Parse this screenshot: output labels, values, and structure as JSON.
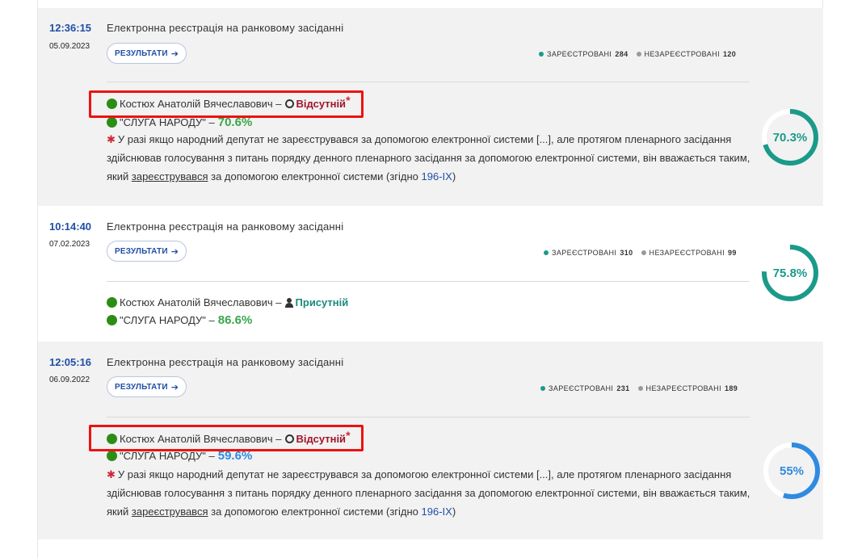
{
  "entries": [
    {
      "time": "12:36:15",
      "date": "05.09.2023",
      "title": "Електронна реєстрація на ранковому засіданні",
      "results_label": "РЕЗУЛЬТАТИ",
      "registered_label": "ЗАРЕЄСТРОВАНІ",
      "registered_count": "284",
      "unregistered_label": "НЕЗАРЕЄСТРОВАНІ",
      "unregistered_count": "120",
      "deputy_name": "Костюх Анатолій Вячеславович –",
      "status": "Відсутній",
      "asterisk": "*",
      "party": "\"СЛУГА НАРОДУ\" –",
      "party_pct": "70.6%",
      "note_line1": "У разі якщо народний депутат не зареєструвався за допомогою електронної системи [...], але протягом пленарного засідання",
      "note_line2": "здійснював голосування з питань порядку денного пленарного засідання за допомогою електронної системи, він вважається таким,",
      "note_line3a": "який ",
      "note_line3_underlined": "зареєструвався",
      "note_line3b": " за допомогою електронної системи (згідно ",
      "note_law": "196-IX",
      "note_close": ")",
      "gauge_label": "70.3%",
      "gauge_value": 70.3
    },
    {
      "time": "10:14:40",
      "date": "07.02.2023",
      "title": "Електронна реєстрація на ранковому засіданні",
      "results_label": "РЕЗУЛЬТАТИ",
      "registered_label": "ЗАРЕЄСТРОВАНІ",
      "registered_count": "310",
      "unregistered_label": "НЕЗАРЕЄСТРОВАНІ",
      "unregistered_count": "99",
      "deputy_name": "Костюх Анатолій Вячеславович –",
      "status": "Присутній",
      "party": "\"СЛУГА НАРОДУ\" –",
      "party_pct": "86.6%",
      "gauge_label": "75.8%",
      "gauge_value": 75.8
    },
    {
      "time": "12:05:16",
      "date": "06.09.2022",
      "title": "Електронна реєстрація на ранковому засіданні",
      "results_label": "РЕЗУЛЬТАТИ",
      "registered_label": "ЗАРЕЄСТРОВАНІ",
      "registered_count": "231",
      "unregistered_label": "НЕЗАРЕЄСТРОВАНІ",
      "unregistered_count": "189",
      "deputy_name": "Костюх Анатолій Вячеславович –",
      "status": "Відсутній",
      "asterisk": "*",
      "party": "\"СЛУГА НАРОДУ\" –",
      "party_pct": "59.6%",
      "note_line1": "У разі якщо народний депутат не зареєструвався за допомогою електронної системи [...], але протягом пленарного засідання",
      "note_line2": "здійснював голосування з питань порядку денного пленарного засідання за допомогою електронної системи, він вважається таким,",
      "note_line3a": "який ",
      "note_line3_underlined": "зареєструвався",
      "note_line3b": " за допомогою електронної системи (згідно ",
      "note_law": "196-IX",
      "note_close": ")",
      "gauge_label": "55%",
      "gauge_value": 55
    }
  ],
  "colors": {
    "gauge_high": "#1b9a8a",
    "gauge_low": "#2f8be0",
    "gauge_track": "#ffffff",
    "highlight": "#ee1111"
  }
}
